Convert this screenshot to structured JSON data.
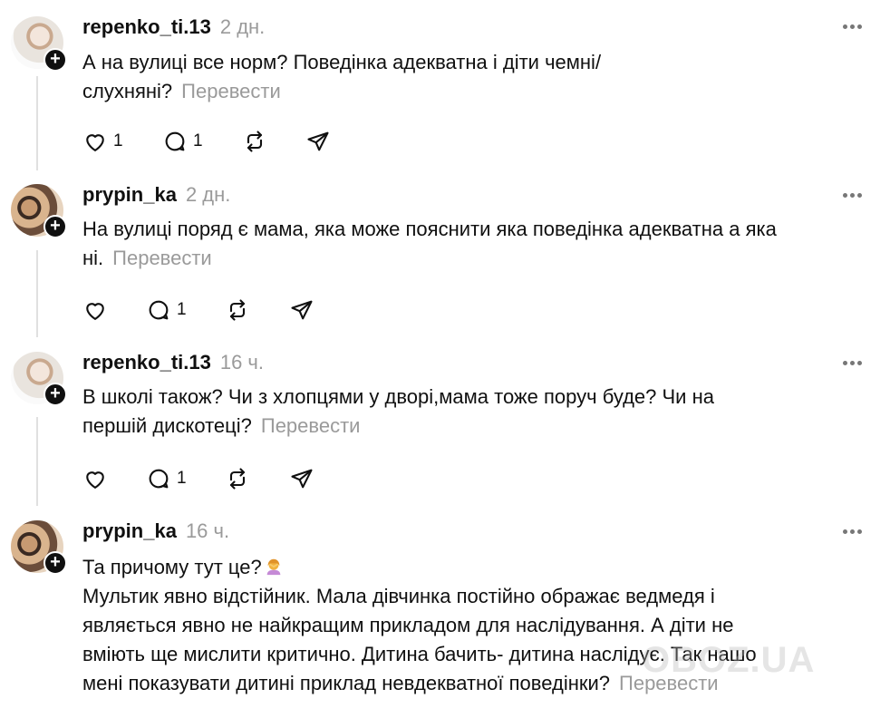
{
  "comments": [
    {
      "username": "repenko_ti.13",
      "time": "2 дн.",
      "text_lines": [
        "А на вулиці все норм? Поведінка адекватна і діти чемні/",
        "слухняні?"
      ],
      "translate_label": "Перевести",
      "likes": "1",
      "replies": "1"
    },
    {
      "username": "prypin_ka",
      "time": "2 дн.",
      "text_lines": [
        "На вулиці поряд є мама, яка може пояснити яка поведінка адекватна а яка",
        "ні."
      ],
      "translate_label": "Перевести",
      "likes": "",
      "replies": "1"
    },
    {
      "username": "repenko_ti.13",
      "time": "16 ч.",
      "text_lines": [
        "В школі також? Чи з хлопцями у дворі,мама тоже поруч буде? Чи на",
        "першій дискотеці?"
      ],
      "translate_label": "Перевести",
      "likes": "",
      "replies": "1"
    },
    {
      "username": "prypin_ka",
      "time": "16 ч.",
      "text_lines": [
        "Та причому тут це?",
        "Мультик явно відстійник. Мала дівчинка постійно ображає ведмедя і",
        "являється явно не найкращим прикладом для наслідування. А діти не",
        "вміють ще мислити критично. Дитина бачить- дитина наслідує. Так нашо",
        "мені показувати дитині приклад невдекватної поведінки?"
      ],
      "translate_label": "Перевести"
    }
  ],
  "icons": {
    "like": "heart-icon",
    "reply": "comment-bubble-icon",
    "repost": "repost-icon",
    "share": "send-icon",
    "more": "more-dots-icon",
    "follow": "plus-icon"
  },
  "watermark": "OBOZ.UA",
  "colors": {
    "text": "#101010",
    "muted": "#9a9a9a",
    "thread_line": "#e0e0e0"
  }
}
